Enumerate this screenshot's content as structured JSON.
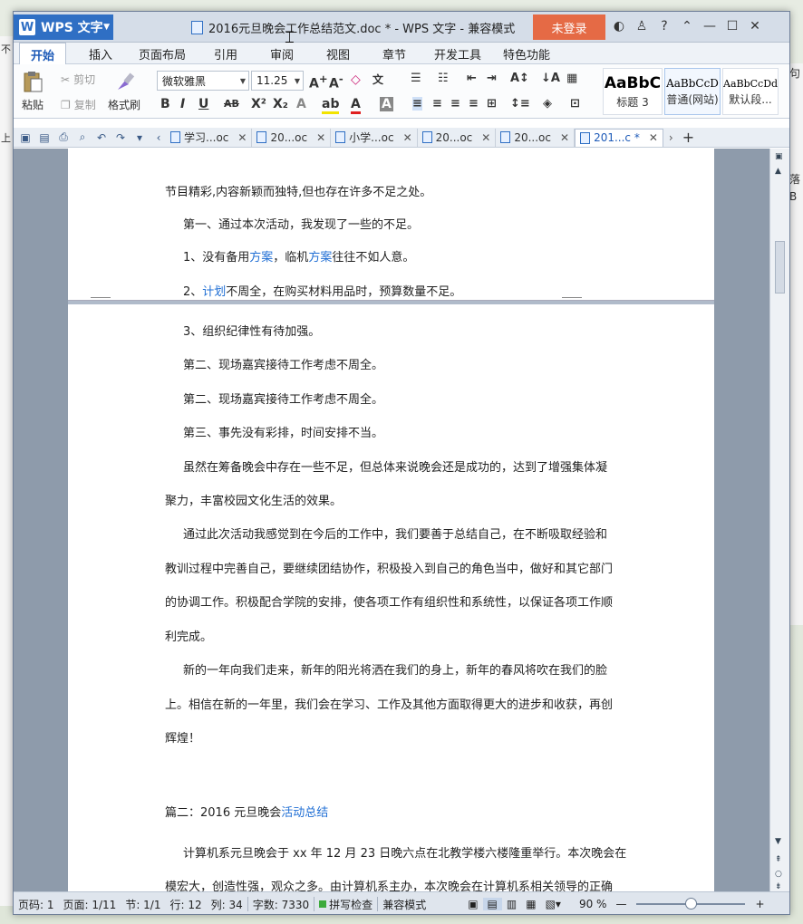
{
  "background": {
    "left_items": [
      "不",
      "上"
    ],
    "right_items": [
      "句",
      "落",
      "B"
    ]
  },
  "app": {
    "logo_letter": "W",
    "name": "WPS 文字",
    "title": "2016元旦晚会工作总结范文.doc * - WPS 文字 - 兼容模式",
    "login_label": "未登录"
  },
  "menu": {
    "items": [
      "开始",
      "插入",
      "页面布局",
      "引用",
      "审阅",
      "视图",
      "章节",
      "开发工具",
      "特色功能"
    ],
    "active": "开始"
  },
  "ribbon": {
    "paste": "粘贴",
    "cut": "剪切",
    "copy": "复制",
    "format_painter": "格式刷",
    "font_name": "微软雅黑",
    "font_size": "11.25",
    "styles": [
      {
        "sample": "AaBbC",
        "label": "标题 3"
      },
      {
        "sample": "AaBbCcD",
        "label": "普通(网站)"
      },
      {
        "sample": "AaBbCcDd",
        "label": "默认段..."
      }
    ]
  },
  "tabs": [
    {
      "label": "学习...oc",
      "active": false
    },
    {
      "label": "20...oc",
      "active": false
    },
    {
      "label": "小学...oc",
      "active": false
    },
    {
      "label": "20...oc",
      "active": false
    },
    {
      "label": "20...oc",
      "active": false
    },
    {
      "label": "201...c *",
      "active": true
    }
  ],
  "document": {
    "page1_lines": [
      {
        "text": "节目精彩,内容新颖而独特,但也存在许多不足之处。"
      },
      {
        "text": "第一、通过本次活动，我发现了一些的不足。"
      },
      {
        "pre": "1、没有备用",
        "link1": "方案",
        "mid": "，临机",
        "link2": "方案",
        "post": "往往不如人意。"
      },
      {
        "pre": "2、",
        "link1": "计划",
        "post": "不周全，在购买材料用品时，预算数量不足。"
      }
    ],
    "page2_lines": [
      "3、组织纪律性有待加强。",
      "第二、现场嘉宾接待工作考虑不周全。",
      "第二、现场嘉宾接待工作考虑不周全。",
      "第三、事先没有彩排，时间安排不当。",
      "虽然在筹备晚会中存在一些不足，但总体来说晚会还是成功的，达到了增强集体凝",
      "聚力，丰富校园文化生活的效果。",
      "通过此次活动我感觉到在今后的工作中，我们要善于总结自己，在不断吸取经验和",
      "教训过程中完善自己，要继续团结协作，积极投入到自己的角色当中，做好和其它部门",
      "的协调工作。积极配合学院的安排，使各项工作有组织性和系统性，以保证各项工作顺",
      "利完成。",
      "新的一年向我们走来，新年的阳光将洒在我们的身上，新年的春风将吹在我们的脸",
      "上。相信在新的一年里，我们会在学习、工作及其他方面取得更大的进步和收获，再创",
      "辉煌！"
    ],
    "section_title_pre": "篇二：2016 元旦晚会",
    "section_title_link": "活动总结",
    "section_lines": [
      "计算机系元旦晚会于 xx 年 12 月 23 日晚六点在北教学楼六楼隆重举行。本次晚会在",
      "模宏大，创造性强，观众之多。由计算机系主办，本次晚会在计算机系相关领导的正确"
    ]
  },
  "status": {
    "page_label": "页码: 1",
    "page_count": "页面: 1/11",
    "section": "节: 1/1",
    "row": "行: 12",
    "col": "列: 34",
    "words": "字数: 7330",
    "spell": "拼写检查",
    "mode": "兼容模式",
    "zoom": "90 %",
    "zoom_level_percent": 90
  },
  "colors": {
    "accent": "#2f6fc4",
    "login": "#e56a45",
    "link": "#1f6ed4"
  }
}
